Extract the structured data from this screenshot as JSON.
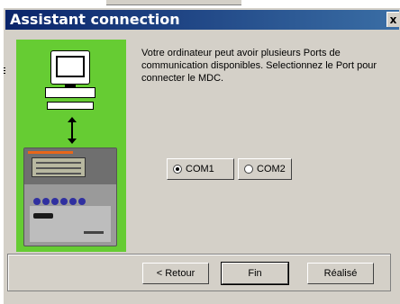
{
  "window": {
    "title": "Assistant connection",
    "close_label": "x"
  },
  "illustration": {
    "computer": "computer-icon",
    "link": "double-arrow-icon",
    "device": "controller-device-icon"
  },
  "message": "Votre ordinateur peut avoir plusieurs Ports de communication disponibles. Selectionnez le Port pour connecter le MDC.",
  "ports": [
    {
      "label": "COM1",
      "selected": true
    },
    {
      "label": "COM2",
      "selected": false
    }
  ],
  "buttons": {
    "back": "< Retour",
    "finish": "Fin",
    "done": "Réalisé"
  },
  "colors": {
    "titlebar": "#0a246a",
    "illustration_bg": "#66cc33",
    "dialog_bg": "#d4d0c8"
  }
}
